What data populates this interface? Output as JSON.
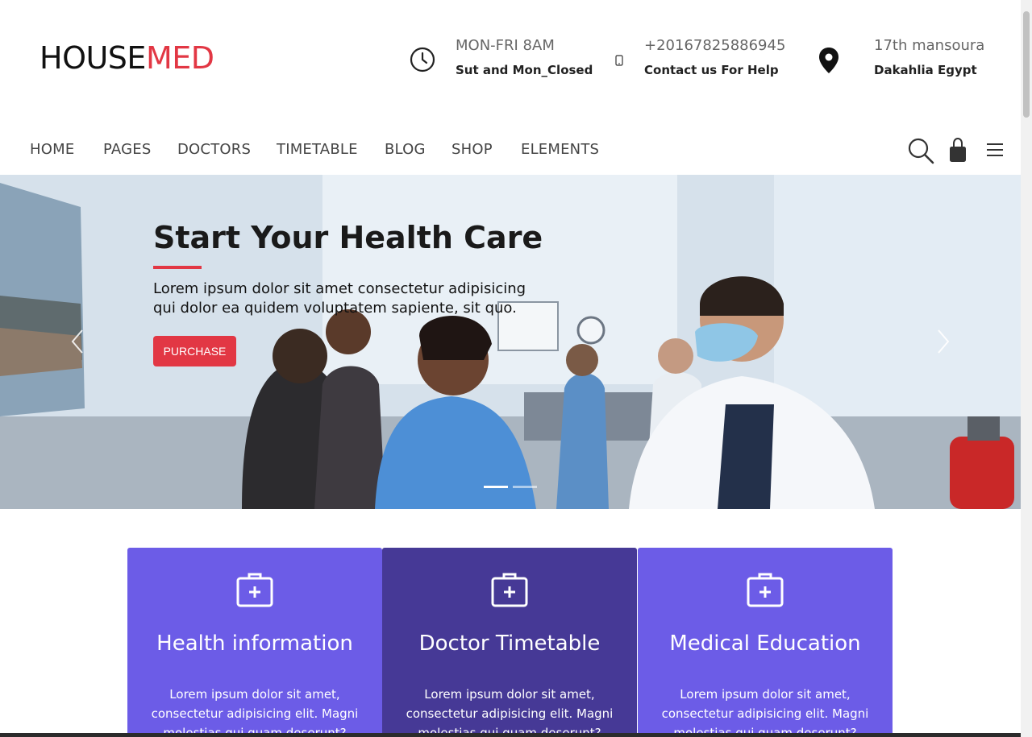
{
  "brand": {
    "name_part1": "HOUSE",
    "name_part2": "MED",
    "accent": "#e23744"
  },
  "contact": {
    "hours": {
      "icon": "clock-icon",
      "main": "MON-FRI 8AM",
      "sub": "Sut and Mon_Closed"
    },
    "phone": {
      "icon": "phone-icon",
      "main": "+20167825886945",
      "sub": "Contact us For Help"
    },
    "location": {
      "icon": "map-pin-icon",
      "main": "17th mansoura",
      "sub": "Dakahlia Egypt"
    }
  },
  "nav": {
    "items": [
      {
        "label": "HOME"
      },
      {
        "label": "PAGES"
      },
      {
        "label": "DOCTORS"
      },
      {
        "label": "TIMETABLE"
      },
      {
        "label": "BLOG"
      },
      {
        "label": "SHOP"
      },
      {
        "label": "ELEMENTS"
      }
    ],
    "tools": [
      "search-icon",
      "shopping-bag-icon",
      "hamburger-menu-icon"
    ]
  },
  "hero": {
    "title": "Start Your Health Care",
    "description": "Lorem ipsum dolor sit amet consectetur adipisicing qui dolor ea quidem voluptatem sapiente, sit quo.",
    "button_label": "PURCHASE",
    "slides_count": 2,
    "active_slide": 1
  },
  "features": [
    {
      "icon": "medical-kit-icon",
      "title": "Health information",
      "text": "Lorem ipsum dolor sit amet, consectetur adipisicing elit. Magni molestias qui quam deserunt? Veniam, velit.",
      "color": "#6c5ce7"
    },
    {
      "icon": "medical-kit-icon",
      "title": "Doctor Timetable",
      "text": "Lorem ipsum dolor sit amet, consectetur adipisicing elit. Magni molestias qui quam deserunt? Veniam, velit.",
      "color": "#463996"
    },
    {
      "icon": "medical-kit-icon",
      "title": "Medical Education",
      "text": "Lorem ipsum dolor sit amet, consectetur adipisicing elit. Magni molestias qui quam deserunt? Veniam, velit.",
      "color": "#6c5ce7"
    }
  ]
}
